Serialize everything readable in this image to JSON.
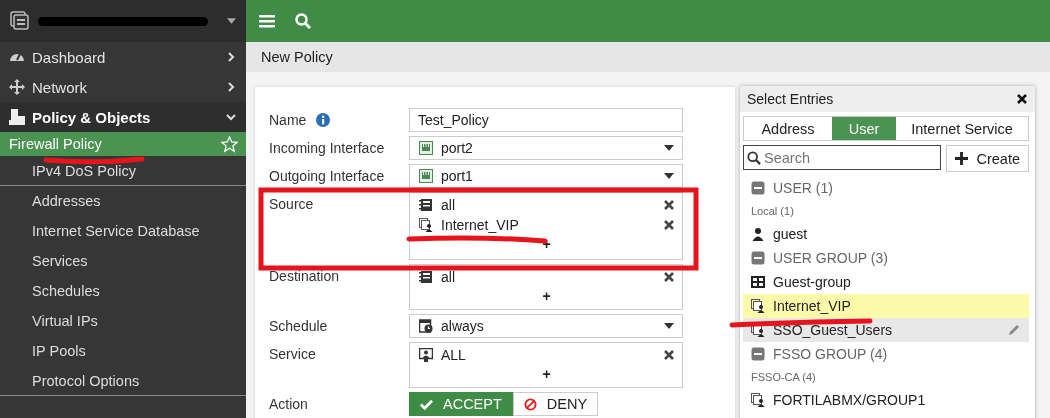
{
  "sidebar": {
    "items": [
      {
        "label": "Dashboard",
        "kind": "dashboard",
        "expanded": false
      },
      {
        "label": "Network",
        "kind": "network",
        "expanded": false
      },
      {
        "label": "Policy & Objects",
        "kind": "policy",
        "expanded": true,
        "children": [
          {
            "label": "Firewall Policy",
            "selected": true,
            "group_end": false
          },
          {
            "label": "IPv4 DoS Policy",
            "selected": false,
            "group_end": true
          },
          {
            "label": "Addresses",
            "selected": false,
            "group_end": false
          },
          {
            "label": "Internet Service Database",
            "selected": false,
            "group_end": false
          },
          {
            "label": "Services",
            "selected": false,
            "group_end": false
          },
          {
            "label": "Schedules",
            "selected": false,
            "group_end": false
          },
          {
            "label": "Virtual IPs",
            "selected": false,
            "group_end": false
          },
          {
            "label": "IP Pools",
            "selected": false,
            "group_end": false
          },
          {
            "label": "Protocol Options",
            "selected": false,
            "group_end": true
          }
        ]
      }
    ]
  },
  "page_title": "New Policy",
  "form": {
    "fields": [
      {
        "label": "Name",
        "kind": "text",
        "info": true,
        "value": "Test_Policy"
      },
      {
        "label": "Incoming Interface",
        "kind": "port-select",
        "info": false,
        "value": "port2"
      },
      {
        "label": "Outgoing Interface",
        "kind": "port-select",
        "info": false,
        "value": "port1"
      },
      {
        "label": "Source",
        "kind": "multi",
        "info": false,
        "entries": [
          {
            "label": "all",
            "kind": "address"
          },
          {
            "label": "Internet_VIP",
            "kind": "user-group"
          }
        ],
        "add": "+"
      },
      {
        "label": "Destination",
        "kind": "multi",
        "info": false,
        "entries": [
          {
            "label": "all",
            "kind": "address"
          }
        ],
        "add": "+"
      },
      {
        "label": "Schedule",
        "kind": "schedule-select",
        "info": false,
        "value": "always"
      },
      {
        "label": "Service",
        "kind": "multi",
        "info": false,
        "entries": [
          {
            "label": "ALL",
            "kind": "service"
          }
        ],
        "add": "+"
      },
      {
        "label": "Action",
        "kind": "buttons",
        "info": false,
        "options": [
          {
            "label": "ACCEPT",
            "kind": "accept",
            "selected": true
          },
          {
            "label": "DENY",
            "kind": "deny",
            "selected": false
          }
        ]
      }
    ]
  },
  "select_entries": {
    "title": "Select Entries",
    "tabs": [
      {
        "label": "Address",
        "selected": false
      },
      {
        "label": "User",
        "selected": true
      },
      {
        "label": "Internet Service",
        "selected": false
      }
    ],
    "search": {
      "placeholder": "Search"
    },
    "create_button": "Create",
    "list": [
      {
        "label": "USER (1)",
        "kind": "category",
        "selected": false,
        "hovered": false
      },
      {
        "label": "Local (1)",
        "kind": "subcategory",
        "selected": false,
        "hovered": false
      },
      {
        "label": "guest",
        "kind": "user",
        "selected": false,
        "hovered": false
      },
      {
        "label": "USER GROUP (3)",
        "kind": "category",
        "selected": false,
        "hovered": false
      },
      {
        "label": "Guest-group",
        "kind": "guest-group",
        "selected": false,
        "hovered": false
      },
      {
        "label": "Internet_VIP",
        "kind": "user-group",
        "selected": true,
        "hovered": false
      },
      {
        "label": "SSO_Guest_Users",
        "kind": "user-group",
        "selected": false,
        "hovered": true
      },
      {
        "label": "FSSO GROUP (4)",
        "kind": "category",
        "selected": false,
        "hovered": false
      },
      {
        "label": "FSSO-CA (4)",
        "kind": "subcategory",
        "selected": false,
        "hovered": false
      },
      {
        "label": "FORTILABMX/GROUP1",
        "kind": "user-group",
        "selected": false,
        "hovered": false
      }
    ]
  }
}
